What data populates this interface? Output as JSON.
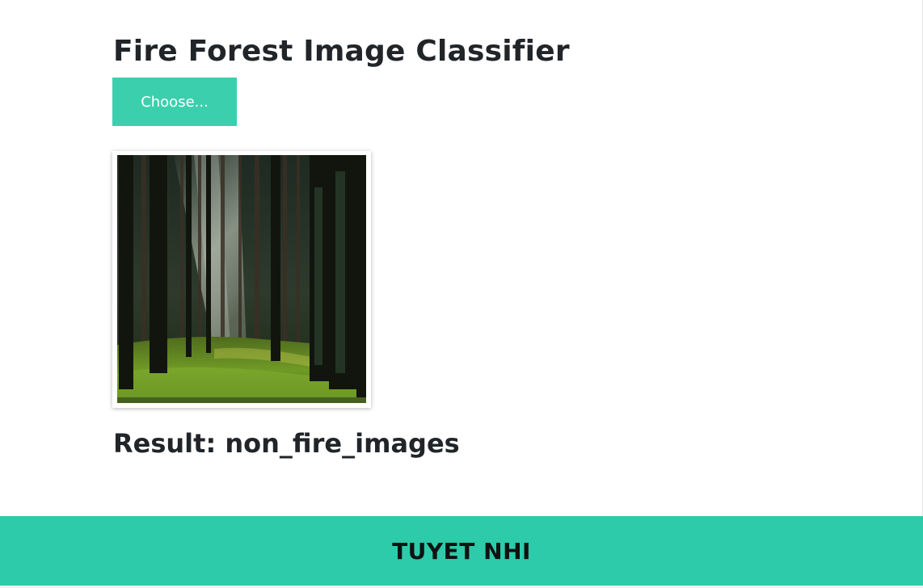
{
  "header": {
    "title": "Fire Forest Image Classifier"
  },
  "upload": {
    "button_label": "Choose..."
  },
  "preview": {
    "image_description_icon": "forest-photo"
  },
  "result": {
    "text": "Result: non_fire_images"
  },
  "footer": {
    "text": "TUYET NHI"
  },
  "colors": {
    "accent": "#3ccfae",
    "footer_bg": "#2dcba9",
    "text": "#212529"
  }
}
